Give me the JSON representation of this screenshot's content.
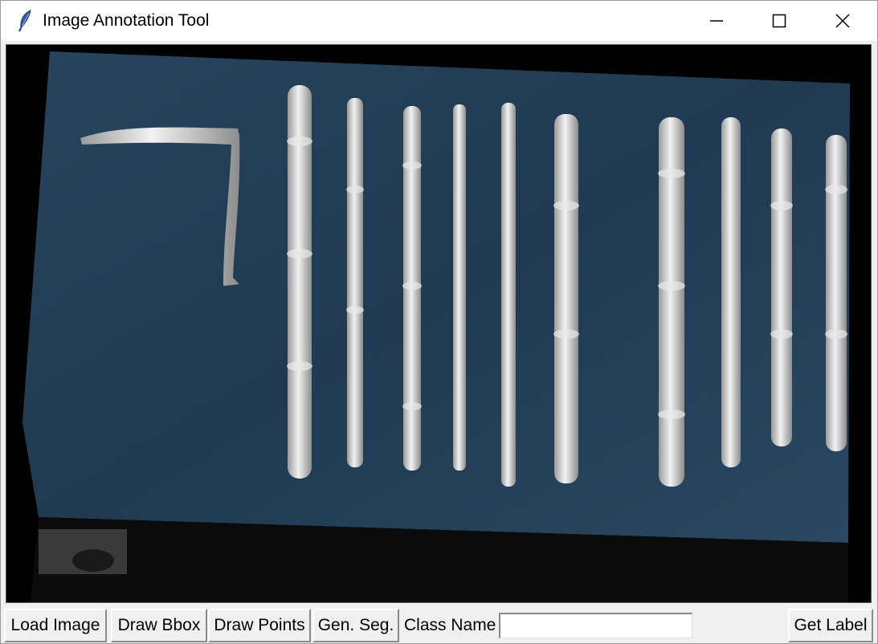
{
  "window": {
    "title": "Image Annotation Tool",
    "app_icon": "feather-icon",
    "controls": {
      "minimize_icon": "minimize-icon",
      "maximize_icon": "maximize-icon",
      "close_icon": "close-icon"
    }
  },
  "canvas": {
    "content": "loaded-image",
    "background_color": "#000000",
    "board_color": "#1f3a52",
    "stroke_color": "#d9d9d9"
  },
  "toolbar": {
    "load_image_label": "Load Image",
    "draw_bbox_label": "Draw Bbox",
    "draw_points_label": "Draw Points",
    "gen_seg_label": "Gen. Seg.",
    "class_name_label": "Class Name",
    "class_name_value": "",
    "get_label_label": "Get Label"
  }
}
